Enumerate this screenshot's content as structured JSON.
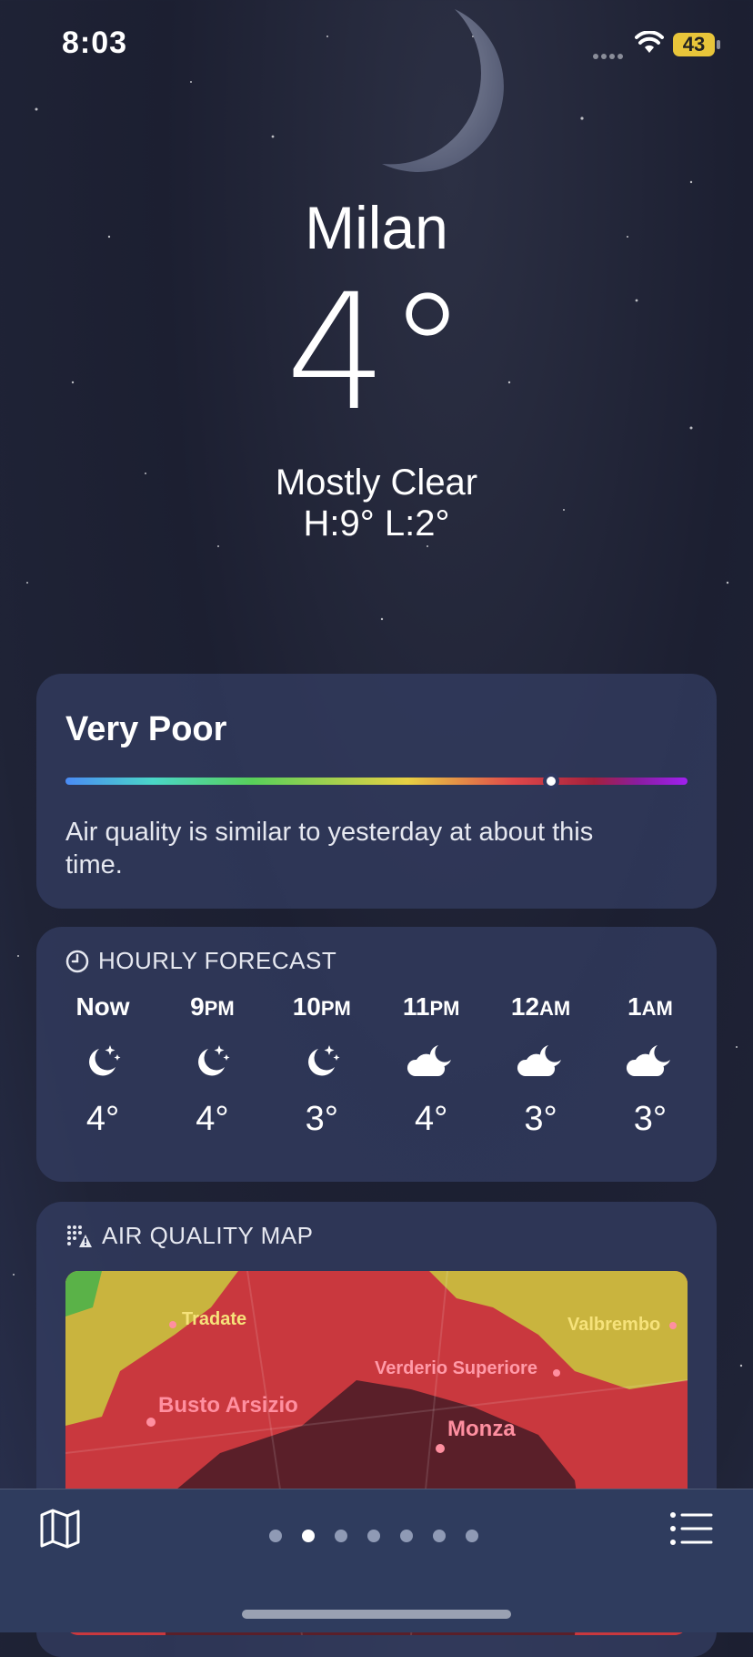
{
  "status": {
    "time": "8:03",
    "battery": "43"
  },
  "location": {
    "city": "Milan",
    "temperature": "4°",
    "condition": "Mostly Clear",
    "high_low": "H:9°  L:2°"
  },
  "air_quality": {
    "category": "Very Poor",
    "level_fraction": 0.78,
    "description": "Air quality is similar to yesterday at about this time."
  },
  "hourly": {
    "header": "HOURLY FORECAST",
    "items": [
      {
        "label": "Now",
        "suffix": "",
        "icon": "moon-stars-icon",
        "temp": "4°"
      },
      {
        "label": "9",
        "suffix": "PM",
        "icon": "moon-stars-icon",
        "temp": "4°"
      },
      {
        "label": "10",
        "suffix": "PM",
        "icon": "moon-stars-icon",
        "temp": "3°"
      },
      {
        "label": "11",
        "suffix": "PM",
        "icon": "cloud-moon-icon",
        "temp": "4°"
      },
      {
        "label": "12",
        "suffix": "AM",
        "icon": "cloud-moon-icon",
        "temp": "3°"
      },
      {
        "label": "1",
        "suffix": "AM",
        "icon": "cloud-moon-icon",
        "temp": "3°"
      }
    ]
  },
  "air_quality_map": {
    "header": "AIR QUALITY MAP",
    "places": [
      "Tradate",
      "Valbrembo",
      "Verderio Superiore",
      "Busto Arsizio",
      "Monza"
    ]
  },
  "bottom_bar": {
    "page_count": 7,
    "active_page": 1
  }
}
